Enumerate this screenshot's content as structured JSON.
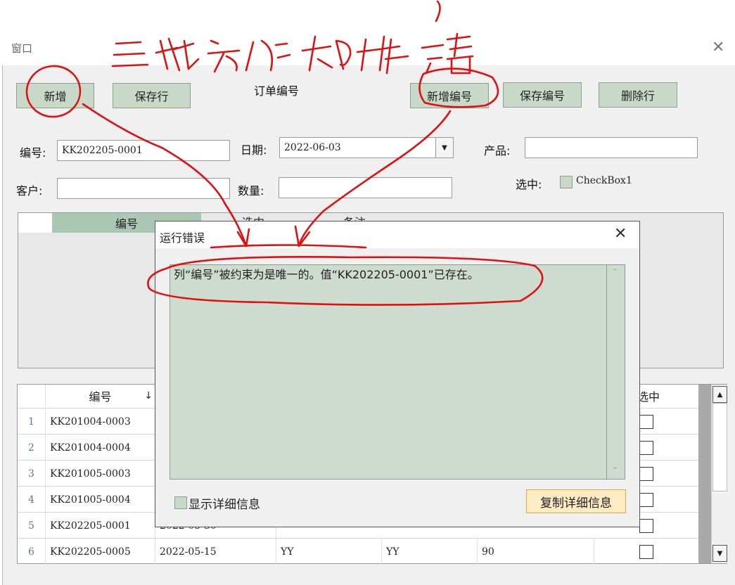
{
  "window": {
    "title": "窗口"
  },
  "buttons": {
    "add": "新增",
    "save_row": "保存行",
    "add_number": "新增编号",
    "save_number": "保存编号",
    "delete_row": "删除行"
  },
  "form": {
    "order_title": "订单编号",
    "number_label": "编号:",
    "number_value": "KK202205-0001",
    "date_label": "日期:",
    "date_value": "2022-06-03",
    "product_label": "产品:",
    "product_value": "",
    "customer_label": "客户:",
    "customer_value": "",
    "qty_label": "数量:",
    "qty_value": "",
    "selected_label": "选中:",
    "checkbox_label": "CheckBox1"
  },
  "top_grid": {
    "columns": [
      "编号",
      "选中",
      "备注"
    ]
  },
  "table": {
    "columns": [
      "编号",
      "",
      "",
      "",
      "",
      "选中"
    ],
    "sort_arrow": "↓",
    "rows": [
      {
        "idx": "1",
        "cells": [
          "KK201004-0003",
          "",
          "",
          "",
          ""
        ]
      },
      {
        "idx": "2",
        "cells": [
          "KK201004-0004",
          "",
          "",
          "",
          ""
        ]
      },
      {
        "idx": "3",
        "cells": [
          "KK201005-0003",
          "",
          "",
          "",
          ""
        ]
      },
      {
        "idx": "4",
        "cells": [
          "KK201005-0004",
          "",
          "",
          "",
          ""
        ]
      },
      {
        "idx": "5",
        "cells": [
          "KK202205-0001",
          "2022-05-30",
          "",
          "",
          ""
        ]
      },
      {
        "idx": "6",
        "cells": [
          "KK202205-0005",
          "2022-05-15",
          "YY",
          "YY",
          "90"
        ]
      }
    ]
  },
  "dialog": {
    "title": "运行错误",
    "message": "列“编号”被约束为是唯一的。值“KK202205-0001”已存在。",
    "show_details": "显示详细信息",
    "copy_details": "复制详细信息"
  },
  "annotation": {
    "text": "三种方法都报错"
  }
}
